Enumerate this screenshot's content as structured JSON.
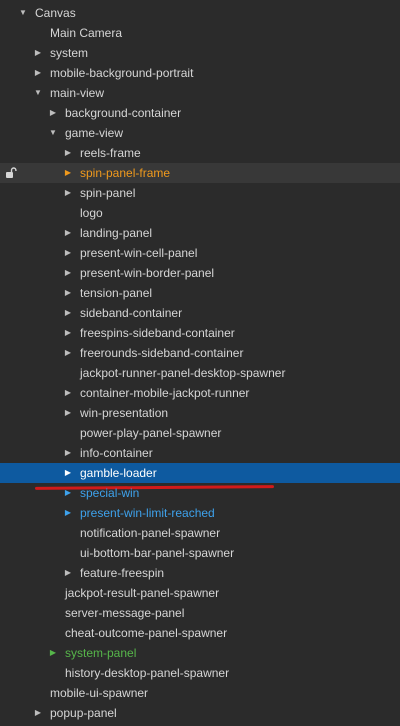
{
  "hierarchy": {
    "rows": [
      {
        "label": "Canvas",
        "arrow": "expanded"
      },
      {
        "label": "Main Camera",
        "arrow": "none"
      },
      {
        "label": "system",
        "arrow": "collapsed"
      },
      {
        "label": "mobile-background-portrait",
        "arrow": "collapsed"
      },
      {
        "label": "main-view",
        "arrow": "expanded"
      },
      {
        "label": "background-container",
        "arrow": "collapsed"
      },
      {
        "label": "game-view",
        "arrow": "expanded"
      },
      {
        "label": "reels-frame",
        "arrow": "collapsed"
      },
      {
        "label": "spin-panel-frame",
        "arrow": "collapsed",
        "color": "orange",
        "locked": true
      },
      {
        "label": "spin-panel",
        "arrow": "collapsed"
      },
      {
        "label": "logo",
        "arrow": "none"
      },
      {
        "label": "landing-panel",
        "arrow": "collapsed"
      },
      {
        "label": "present-win-cell-panel",
        "arrow": "collapsed"
      },
      {
        "label": "present-win-border-panel",
        "arrow": "collapsed"
      },
      {
        "label": "tension-panel",
        "arrow": "collapsed"
      },
      {
        "label": "sideband-container",
        "arrow": "collapsed"
      },
      {
        "label": "freespins-sideband-container",
        "arrow": "collapsed"
      },
      {
        "label": "freerounds-sideband-container",
        "arrow": "collapsed"
      },
      {
        "label": "jackpot-runner-panel-desktop-spawner",
        "arrow": "none"
      },
      {
        "label": "container-mobile-jackpot-runner",
        "arrow": "collapsed"
      },
      {
        "label": "win-presentation",
        "arrow": "collapsed"
      },
      {
        "label": "power-play-panel-spawner",
        "arrow": "none"
      },
      {
        "label": "info-container",
        "arrow": "collapsed"
      },
      {
        "label": "gamble-loader",
        "arrow": "collapsed",
        "selected": true
      },
      {
        "label": "special-win",
        "arrow": "collapsed",
        "color": "blue"
      },
      {
        "label": "present-win-limit-reached",
        "arrow": "collapsed",
        "color": "blue"
      },
      {
        "label": "notification-panel-spawner",
        "arrow": "none"
      },
      {
        "label": "ui-bottom-bar-panel-spawner",
        "arrow": "none"
      },
      {
        "label": "feature-freespin",
        "arrow": "collapsed"
      },
      {
        "label": "jackpot-result-panel-spawner",
        "arrow": "none"
      },
      {
        "label": "server-message-panel",
        "arrow": "none"
      },
      {
        "label": "cheat-outcome-panel-spawner",
        "arrow": "none"
      },
      {
        "label": "system-panel",
        "arrow": "collapsed",
        "color": "green"
      },
      {
        "label": "history-desktop-panel-spawner",
        "arrow": "none"
      },
      {
        "label": "mobile-ui-spawner",
        "arrow": "none"
      },
      {
        "label": "popup-panel",
        "arrow": "collapsed"
      }
    ]
  },
  "icons": {
    "expanded": "triangle-down-icon",
    "collapsed": "triangle-right-icon",
    "lock": "unlocked-padlock-icon"
  },
  "colors": {
    "background": "#2b2b2b",
    "text": "#d6d6d6",
    "selected_row": "#0e5aa0",
    "hover_row": "#383838",
    "orange": "#f09a1d",
    "blue": "#3ea2ec",
    "green": "#56b64a",
    "annotation_red": "#d11a1a"
  }
}
